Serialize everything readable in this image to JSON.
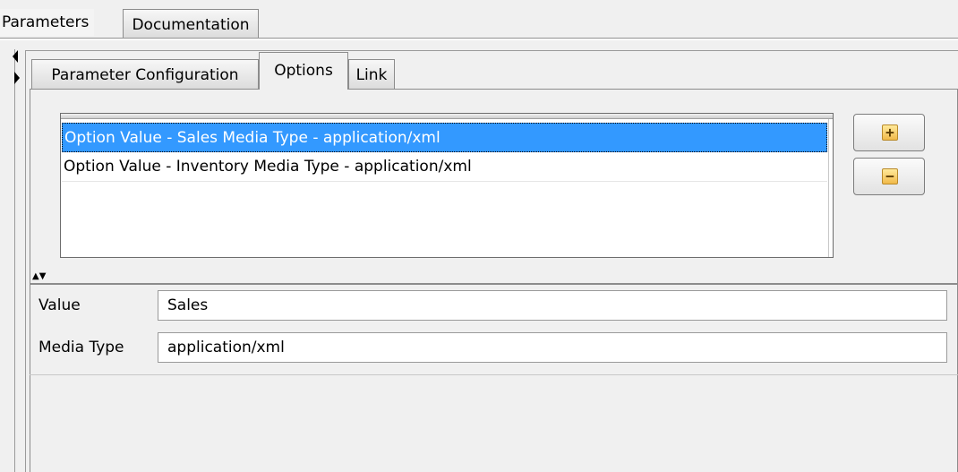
{
  "top_tabs": [
    {
      "label": "Parameters"
    },
    {
      "label": "Documentation"
    }
  ],
  "inner_tabs": [
    {
      "label": "Parameter Configuration"
    },
    {
      "label": "Options"
    },
    {
      "label": "Link"
    }
  ],
  "options_list": {
    "items": [
      {
        "label": "Option Value - Sales Media Type - application/xml"
      },
      {
        "label": "Option Value - Inventory Media Type - application/xml"
      }
    ],
    "selected_index": 0
  },
  "buttons": {
    "add_glyph": "+",
    "remove_glyph": "−"
  },
  "splitter": {
    "arrows": "▲▼"
  },
  "form": {
    "value_label": "Value",
    "value": "Sales",
    "media_type_label": "Media Type",
    "media_type": "application/xml"
  },
  "colors": {
    "selection": "#3399ff",
    "background": "#f0f0f0"
  },
  "icons": [
    "add-icon",
    "remove-icon",
    "collapse-left-icon",
    "expand-right-icon",
    "split-arrows-icon"
  ]
}
